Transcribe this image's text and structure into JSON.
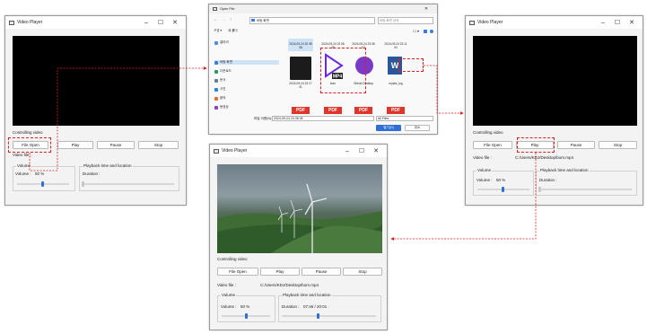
{
  "player": {
    "title": "Video Player",
    "controlling_label": "Controlling video",
    "file_open": "File Open",
    "play": "Play",
    "pause": "Pause",
    "stop": "Stop",
    "video_file_label": "Video file :",
    "volume_group": "Volume",
    "volume_label": "Volume :",
    "volume_value": "50 %",
    "playback_group": "Playback time and location",
    "duration_label": "Duration :",
    "min": "–",
    "max": "☐",
    "close": "✕"
  },
  "player3": {
    "video_file_value": "C:/Users/KDJ/Desktop/bom.mp4"
  },
  "player4": {
    "video_file_value": "C:/Users/KDJ/Desktop/bom.mp4",
    "duration_value": "07:46 / 20:01",
    "volume_level": 0.5,
    "playback_position": 0.39
  },
  "explorer": {
    "title": "Open File",
    "path": "바탕 화면",
    "search_placeholder": "바탕 화면 검색",
    "organize": "구성 ▾",
    "new_folder": "새 폴더",
    "sidebar": [
      "갤러리",
      "바탕 화면",
      "다운로드",
      "문서",
      "사진",
      "음악",
      "동영상"
    ],
    "thumbs_top": [
      "2024-09-24 20 08 08",
      "2024-09-24 23 08 08",
      "2024-09-24 23 08 07",
      "2024-09-24 23 11 00"
    ],
    "thumbs_mid": [
      "2024-09-24 23 17 31",
      "bom",
      "Github Desktop",
      "mystic_log"
    ],
    "filename_label": "파일 이름(N):",
    "filename_value": "2024-09-24 23 08 08",
    "filetype": "All Files",
    "open_btn": "열기(O)",
    "cancel_btn": "취소",
    "pdf": "PDF",
    "mp4": "MP4",
    "word": "W"
  },
  "colors": {
    "annotation": "#e02020",
    "slider": "#2f6fd6",
    "mp4_purple": "#6c2bd9",
    "word_blue": "#2b579a"
  }
}
